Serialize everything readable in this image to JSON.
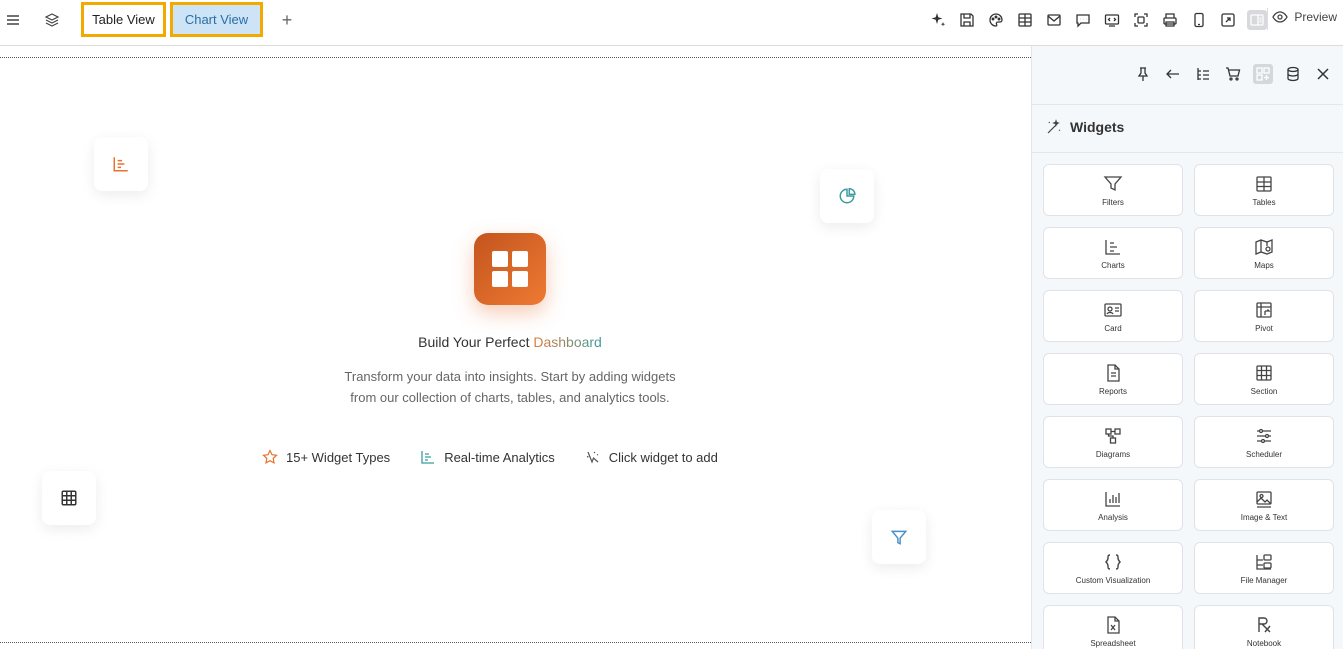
{
  "tabs": {
    "table_label": "Table View",
    "chart_label": "Chart View",
    "add_symbol": "+"
  },
  "toolbar": {
    "preview_label": "Preview",
    "icons": [
      "sparkle-icon",
      "save-icon",
      "palette-icon",
      "table-icon",
      "mail-icon",
      "comment-icon",
      "embed-icon",
      "screenshot-icon",
      "print-icon",
      "mobile-icon",
      "external-link-icon",
      "layout-icon"
    ]
  },
  "hero": {
    "title_prefix": "Build Your Perfect ",
    "title_accent": "Dashboard",
    "description": "Transform your data into insights. Start by adding widgets from our collection of charts, tables, and analytics tools.",
    "features": [
      {
        "icon": "star-icon",
        "label": "15+ Widget Types"
      },
      {
        "icon": "chart-icon",
        "label": "Real-time Analytics"
      },
      {
        "icon": "click-icon",
        "label": "Click widget to add"
      }
    ]
  },
  "panel": {
    "title": "Widgets",
    "widgets": [
      {
        "icon": "filter-icon",
        "label": "Filters"
      },
      {
        "icon": "table-icon",
        "label": "Tables"
      },
      {
        "icon": "chart-icon",
        "label": "Charts"
      },
      {
        "icon": "map-icon",
        "label": "Maps"
      },
      {
        "icon": "card-icon",
        "label": "Card"
      },
      {
        "icon": "pivot-icon",
        "label": "Pivot"
      },
      {
        "icon": "report-icon",
        "label": "Reports"
      },
      {
        "icon": "section-icon",
        "label": "Section"
      },
      {
        "icon": "diagram-icon",
        "label": "Diagrams"
      },
      {
        "icon": "scheduler-icon",
        "label": "Scheduler"
      },
      {
        "icon": "analysis-icon",
        "label": "Analysis"
      },
      {
        "icon": "image-icon",
        "label": "Image & Text"
      },
      {
        "icon": "code-icon",
        "label": "Custom Visualization"
      },
      {
        "icon": "file-manager-icon",
        "label": "File Manager"
      },
      {
        "icon": "spreadsheet-icon",
        "label": "Spreadsheet"
      },
      {
        "icon": "notebook-icon",
        "label": "Notebook"
      }
    ]
  },
  "colors": {
    "accent_orange": "#e8712e",
    "tab_highlight": "#f2a900",
    "teal": "#3a9aa0"
  }
}
